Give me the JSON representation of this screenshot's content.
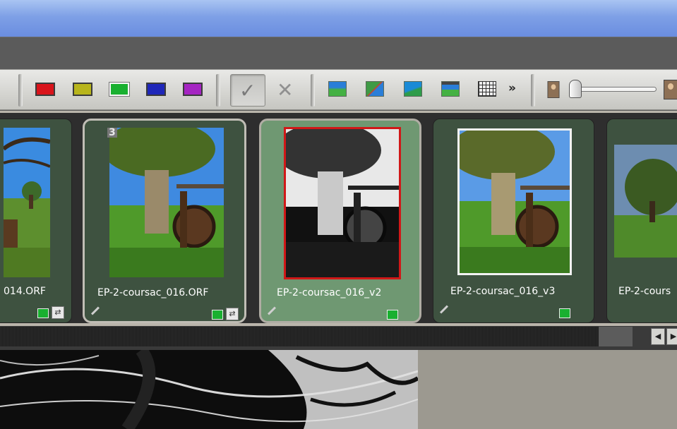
{
  "color_labels": [
    {
      "name": "red",
      "color": "#d9141b",
      "selected": false
    },
    {
      "name": "yellow",
      "color": "#b8b51c",
      "selected": false
    },
    {
      "name": "green",
      "color": "#19b030",
      "selected": true
    },
    {
      "name": "blue",
      "color": "#1f27b9",
      "selected": false
    },
    {
      "name": "purple",
      "color": "#a525c2",
      "selected": false
    }
  ],
  "toolbar": {
    "overflow_label": "»",
    "approve_icon": "check-icon",
    "reject_icon": "x-icon",
    "view_icons": [
      "single-view-icon",
      "compare-view-icon",
      "fit-view-icon",
      "filmstrip-view-icon",
      "grid-view-icon"
    ],
    "thumbnail_size_icons": [
      "small-person-icon",
      "large-person-icon"
    ]
  },
  "filmstrip": {
    "thumbnails": [
      {
        "label": "014.ORF",
        "color_tag": "#19b030",
        "has_doc_icon": true,
        "style": "color",
        "stack_count": ""
      },
      {
        "label": "EP-2-coursac_016.ORF",
        "color_tag": "#19b030",
        "has_doc_icon": true,
        "style": "color",
        "stack_count": "3"
      },
      {
        "label": "EP-2-coursac_016_v2",
        "color_tag": "#19b030",
        "has_doc_icon": false,
        "style": "bw",
        "stack_count": "",
        "selected": true
      },
      {
        "label": "EP-2-coursac_016_v3",
        "color_tag": "#19b030",
        "has_doc_icon": false,
        "style": "color",
        "stack_count": ""
      },
      {
        "label": "EP-2-cours",
        "color_tag": "",
        "has_doc_icon": false,
        "style": "color",
        "stack_count": ""
      }
    ]
  },
  "scrollbar": {
    "left_arrow": "◀",
    "right_arrow": "▶"
  }
}
